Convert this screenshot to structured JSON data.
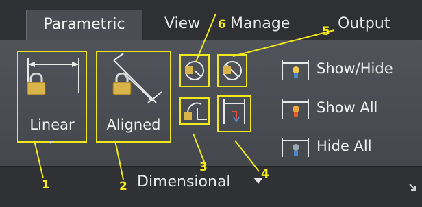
{
  "tabs": [
    "Parametric",
    "View",
    "Manage",
    "Output"
  ],
  "panel_title": "Dimensional",
  "buttons": {
    "linear": "Linear",
    "aligned": "Aligned"
  },
  "toggles": {
    "show_hide": "Show/Hide",
    "show_all": "Show All",
    "hide_all": "Hide All"
  },
  "annotations": [
    "1",
    "2",
    "3",
    "4",
    "5",
    "6"
  ],
  "icons": {
    "lock": "padlock-icon",
    "linear": "linear-dimension-icon",
    "aligned": "aligned-dimension-icon",
    "angular": "angular-dimension-icon",
    "radial": "radial-dimension-icon",
    "diameter": "diameter-dimension-icon",
    "convert": "convert-dimension-icon",
    "bulb": "constraint-bulb-icon"
  },
  "colors": {
    "annotation": "#f0e81c",
    "tab_bar": "#2e3034",
    "panel": "#4a4d52"
  }
}
